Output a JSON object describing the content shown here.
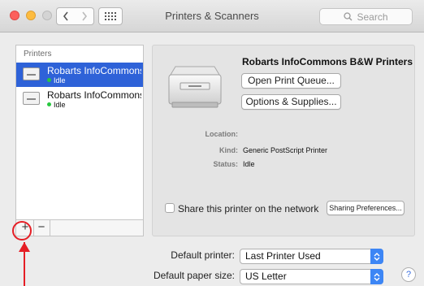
{
  "window": {
    "title": "Printers & Scanners",
    "search_placeholder": "Search"
  },
  "printers": {
    "header": "Printers",
    "items": [
      {
        "name": "Robarts InfoCommons B...",
        "status": "Idle"
      },
      {
        "name": "Robarts InfoCommons...",
        "status": "Idle"
      }
    ],
    "add_label": "+",
    "remove_label": "−"
  },
  "details": {
    "printer_name": "Robarts InfoCommons B&W Printers",
    "open_queue_label": "Open Print Queue...",
    "options_label": "Options & Supplies...",
    "location_label": "Location:",
    "location_value": "",
    "kind_label": "Kind:",
    "kind_value": "Generic PostScript Printer",
    "status_label": "Status:",
    "status_value": "Idle",
    "share_label": "Share this printer on the network",
    "share_checked": false,
    "sharing_prefs_label": "Sharing Preferences..."
  },
  "defaults": {
    "default_printer_label": "Default printer:",
    "default_printer_value": "Last Printer Used",
    "default_paper_label": "Default paper size:",
    "default_paper_value": "US Letter",
    "help_label": "?"
  },
  "colors": {
    "selection": "#2e62d8",
    "status_dot": "#28c840",
    "annotation": "#e51e25",
    "select_accent": "#3d86f5"
  }
}
